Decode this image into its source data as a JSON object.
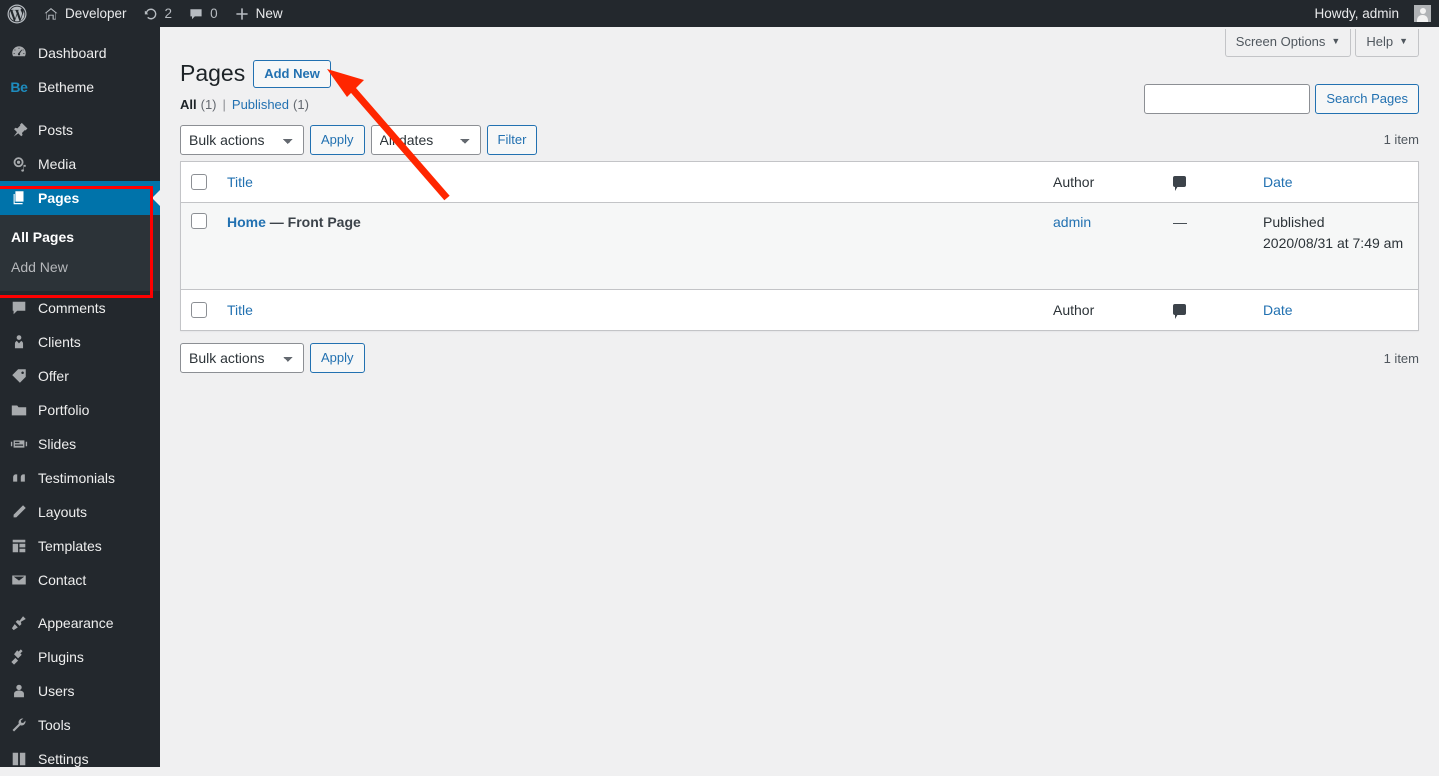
{
  "adminbar": {
    "wp_logo": "wordpress-logo",
    "site_name": "Developer",
    "updates_count": "2",
    "comments_count": "0",
    "new_label": "New",
    "howdy": "Howdy, admin"
  },
  "sidebar": {
    "items": [
      {
        "label": "Dashboard",
        "icon": "dashboard-icon",
        "name": "dashboard"
      },
      {
        "label": "Betheme",
        "icon": "betheme-icon",
        "name": "betheme"
      },
      {
        "label": "Posts",
        "icon": "pin-icon",
        "name": "posts"
      },
      {
        "label": "Media",
        "icon": "media-icon",
        "name": "media"
      },
      {
        "label": "Pages",
        "icon": "pages-icon",
        "name": "pages",
        "current": true
      },
      {
        "label": "Comments",
        "icon": "comment-icon",
        "name": "comments"
      },
      {
        "label": "Clients",
        "icon": "clients-icon",
        "name": "clients"
      },
      {
        "label": "Offer",
        "icon": "offer-icon",
        "name": "offer"
      },
      {
        "label": "Portfolio",
        "icon": "portfolio-icon",
        "name": "portfolio"
      },
      {
        "label": "Slides",
        "icon": "slides-icon",
        "name": "slides"
      },
      {
        "label": "Testimonials",
        "icon": "quote-icon",
        "name": "testimonials"
      },
      {
        "label": "Layouts",
        "icon": "pencil-icon",
        "name": "layouts"
      },
      {
        "label": "Templates",
        "icon": "templates-icon",
        "name": "templates"
      },
      {
        "label": "Contact",
        "icon": "envelope-icon",
        "name": "contact"
      },
      {
        "label": "Appearance",
        "icon": "appearance-icon",
        "name": "appearance"
      },
      {
        "label": "Plugins",
        "icon": "plugin-icon",
        "name": "plugins"
      },
      {
        "label": "Users",
        "icon": "user-icon",
        "name": "users"
      },
      {
        "label": "Tools",
        "icon": "tools-icon",
        "name": "tools"
      },
      {
        "label": "Settings",
        "icon": "settings-icon",
        "name": "settings"
      }
    ],
    "submenu": [
      {
        "label": "All Pages",
        "current": true
      },
      {
        "label": "Add New",
        "current": false
      }
    ]
  },
  "screen_meta": {
    "screen_options": "Screen Options",
    "help": "Help",
    "triangle": "▼"
  },
  "page": {
    "title": "Pages",
    "add_new_label": "Add New"
  },
  "filters": {
    "all_label": "All",
    "all_count": "(1)",
    "separator": "|",
    "published_label": "Published",
    "published_count": "(1)"
  },
  "search": {
    "value": "",
    "placeholder": "",
    "button_label": "Search Pages"
  },
  "tablenav_top": {
    "bulk_actions": "Bulk actions",
    "apply": "Apply",
    "all_dates": "All dates",
    "filter": "Filter",
    "displaying_num": "1 item"
  },
  "tablenav_bottom": {
    "bulk_actions": "Bulk actions",
    "apply": "Apply",
    "displaying_num": "1 item"
  },
  "table": {
    "columns": {
      "title": "Title",
      "author": "Author",
      "comments": "comment-icon",
      "date": "Date"
    },
    "rows": [
      {
        "title": "Home",
        "post_state": "— Front Page",
        "author": "admin",
        "comments": "—",
        "date_status": "Published",
        "date_value": "2020/08/31 at 7:49 am"
      }
    ]
  },
  "annotations": {
    "arrow_color": "#ff2600",
    "highlight_color": "#ff0000",
    "arrow_points_to": "Add New",
    "highlight_around": "Pages menu"
  },
  "colors": {
    "adminbar_bg": "#23282d",
    "sidebar_bg": "#23282d",
    "current_menu_bg": "#0073aa",
    "content_bg": "#f0f0f1",
    "link_blue": "#2271b1",
    "betheme_blue": "#1e8cbe"
  }
}
